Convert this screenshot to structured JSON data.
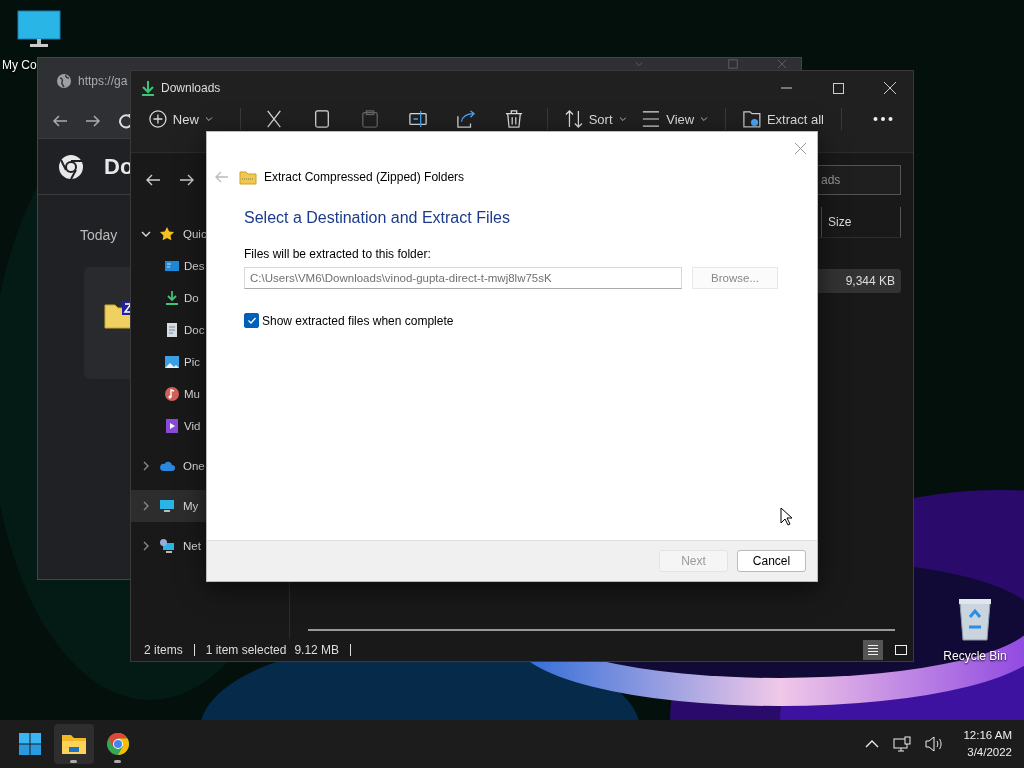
{
  "desktop_icons": [
    {
      "kind": "computer",
      "label": "My Co"
    },
    {
      "kind": "recycle-bin",
      "label": "Recycle Bin"
    }
  ],
  "browser": {
    "address": "https://ga",
    "heading": "Do",
    "group": "Today"
  },
  "explorer": {
    "title": "Downloads",
    "toolbar": [
      {
        "kind": "new",
        "label": "New",
        "disabled": false
      },
      {
        "kind": "cut",
        "disabled": false
      },
      {
        "kind": "copy",
        "disabled": false
      },
      {
        "kind": "paste",
        "disabled": true
      },
      {
        "kind": "rename",
        "disabled": false
      },
      {
        "kind": "share",
        "disabled": false
      },
      {
        "kind": "delete",
        "disabled": false
      },
      {
        "kind": "sort",
        "label": "Sort",
        "disabled": false
      },
      {
        "kind": "view",
        "label": "View",
        "disabled": false
      },
      {
        "kind": "extract",
        "label": "Extract all",
        "disabled": false
      },
      {
        "kind": "more",
        "disabled": false
      }
    ],
    "search": {
      "placeholder": "ads"
    },
    "columns": [
      "Size"
    ],
    "rows": [
      {
        "size": "9,344 KB",
        "selected": true
      }
    ],
    "sidebar": [
      {
        "kind": "star",
        "label": "Quic",
        "expanded": true,
        "selected": false,
        "children": [
          {
            "kind": "desktop",
            "label": "Des",
            "selected": false
          },
          {
            "kind": "download",
            "label": "Do",
            "selected": false
          },
          {
            "kind": "document",
            "label": "Doc",
            "selected": false
          },
          {
            "kind": "pictures",
            "label": "Pic",
            "selected": false
          },
          {
            "kind": "music",
            "label": "Mu",
            "selected": false
          },
          {
            "kind": "videos",
            "label": "Vid",
            "selected": false
          }
        ]
      },
      {
        "kind": "cloud",
        "label": "One",
        "expanded": false,
        "selected": false
      },
      {
        "kind": "computer",
        "label": "My",
        "expanded": false,
        "selected": true
      },
      {
        "kind": "network",
        "label": "Net",
        "expanded": false,
        "selected": false
      }
    ],
    "status_bar": {
      "count": "2 items",
      "selection": "1 item selected",
      "size": "9.12 MB",
      "views": [
        {
          "kind": "details",
          "selected": true
        },
        {
          "kind": "tiles",
          "selected": false
        }
      ]
    }
  },
  "dialog": {
    "title": "Extract Compressed (Zipped) Folders",
    "heading": "Select a Destination and Extract Files",
    "folder_label": "Files will be extracted to this folder:",
    "path": "C:\\Users\\VM6\\Downloads\\vinod-gupta-direct-t-mwj8lw75sK",
    "browse": "Browse...",
    "show_files": {
      "label": "Show extracted files when complete",
      "checked": true
    },
    "buttons": [
      {
        "label": "Next",
        "disabled": true
      },
      {
        "label": "Cancel",
        "disabled": false
      }
    ]
  },
  "taskbar": {
    "apps": [
      {
        "kind": "start",
        "selected": false,
        "running": false
      },
      {
        "kind": "explorer",
        "selected": true,
        "running": true
      },
      {
        "kind": "chrome",
        "selected": false,
        "running": true
      }
    ],
    "clock": {
      "time": "12:16 AM",
      "date": "3/4/2022"
    }
  }
}
